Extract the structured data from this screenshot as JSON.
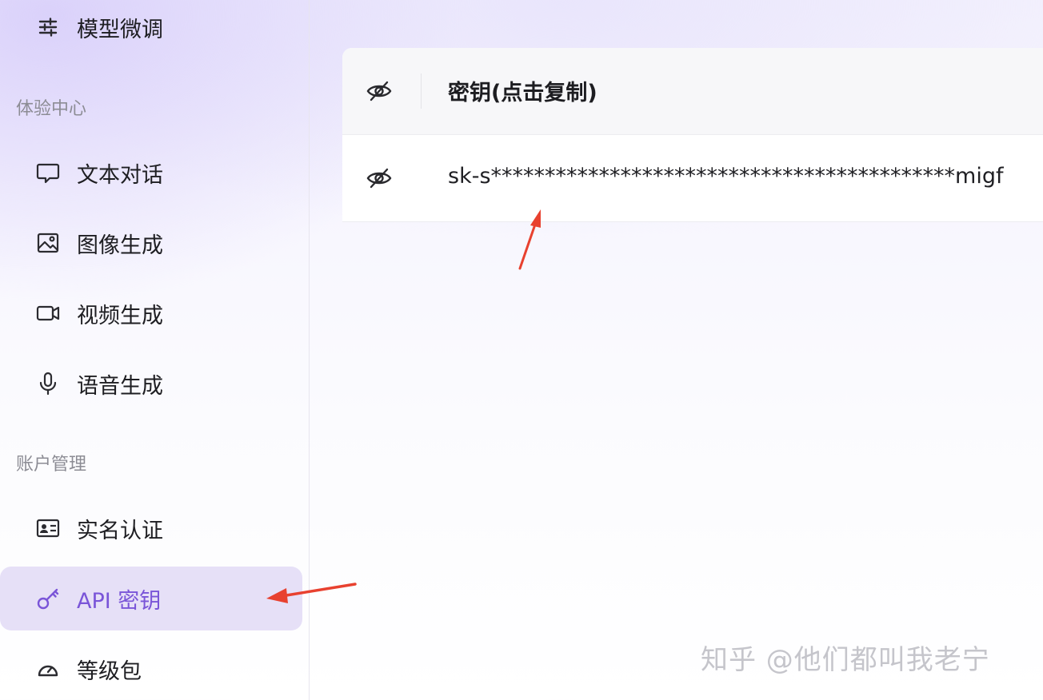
{
  "sidebar": {
    "top_item": {
      "label": "模型微调",
      "icon": "sliders-icon"
    },
    "sections": [
      {
        "title": "体验中心",
        "items": [
          {
            "label": "文本对话",
            "icon": "chat-icon"
          },
          {
            "label": "图像生成",
            "icon": "image-icon"
          },
          {
            "label": "视频生成",
            "icon": "video-icon"
          },
          {
            "label": "语音生成",
            "icon": "microphone-icon"
          }
        ]
      },
      {
        "title": "账户管理",
        "items": [
          {
            "label": "实名认证",
            "icon": "id-card-icon"
          },
          {
            "label": "API 密钥",
            "icon": "key-icon",
            "active": true
          },
          {
            "label": "等级包",
            "icon": "gauge-icon"
          }
        ]
      }
    ],
    "accent_color": "#7a55d8"
  },
  "key_table": {
    "header": {
      "title": "密钥(点击复制)",
      "icon": "eye-off-icon"
    },
    "rows": [
      {
        "key": "sk-s*******************************************migf",
        "icon": "eye-off-icon"
      }
    ]
  },
  "annotations": {
    "arrow_color": "#e8412f",
    "watermark": "知乎 @他们都叫我老宁"
  }
}
